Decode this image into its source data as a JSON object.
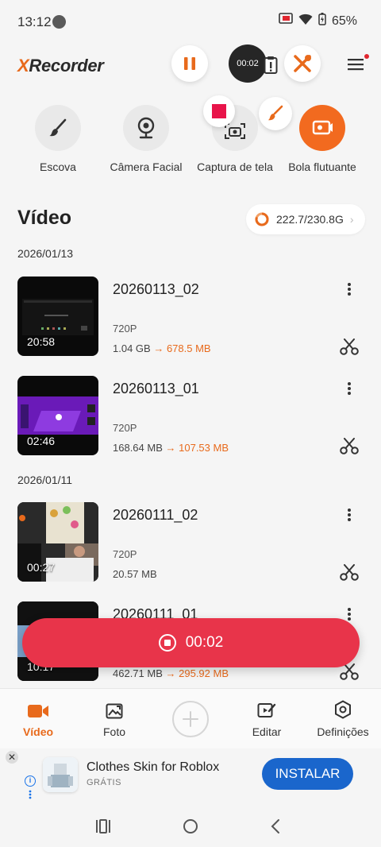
{
  "status_bar": {
    "time": "13:12",
    "battery": "65%"
  },
  "header": {
    "logo_accent": "X",
    "logo_rest": "Recorder",
    "recording_timer": "00:02"
  },
  "quick_tools": [
    {
      "label": "Escova",
      "icon": "brush-icon"
    },
    {
      "label": "Câmera Facial",
      "icon": "webcam-icon"
    },
    {
      "label": "Captura de tela",
      "icon": "screenshot-camera-icon"
    },
    {
      "label": "Bola flutuante",
      "icon": "floating-ball-icon"
    }
  ],
  "section": {
    "title": "Vídeo",
    "storage": "222.7/230.8G"
  },
  "groups": [
    {
      "date": "2026/01/13",
      "videos": [
        {
          "name": "20260113_02",
          "duration": "20:58",
          "resolution": "720P",
          "size": "1.04 GB",
          "compressed": "678.5 MB"
        },
        {
          "name": "20260113_01",
          "duration": "02:46",
          "resolution": "720P",
          "size": "168.64 MB",
          "compressed": "107.53 MB"
        }
      ]
    },
    {
      "date": "2026/01/11",
      "videos": [
        {
          "name": "20260111_02",
          "duration": "00:27",
          "resolution": "720P",
          "size": "20.57 MB",
          "compressed": ""
        },
        {
          "name": "20260111_01",
          "duration": "10:17",
          "resolution": "",
          "size": "462.71 MB",
          "compressed": "295.92 MB"
        }
      ]
    }
  ],
  "recording_bar": {
    "timer": "00:02"
  },
  "bottom_nav": [
    {
      "label": "Vídeo",
      "icon": "video-camera-icon",
      "active": true
    },
    {
      "label": "Foto",
      "icon": "photo-icon",
      "active": false
    },
    {
      "label": "Editar",
      "icon": "edit-video-icon",
      "active": false
    },
    {
      "label": "Definições",
      "icon": "settings-hexagon-icon",
      "active": false
    }
  ],
  "ad": {
    "title": "Clothes Skin for Roblox",
    "subtitle": "GRÁTIS",
    "install_label": "INSTALAR"
  },
  "colors": {
    "accent": "#e86a1c",
    "record_red": "#e8344a",
    "install_blue": "#1a66cc"
  }
}
